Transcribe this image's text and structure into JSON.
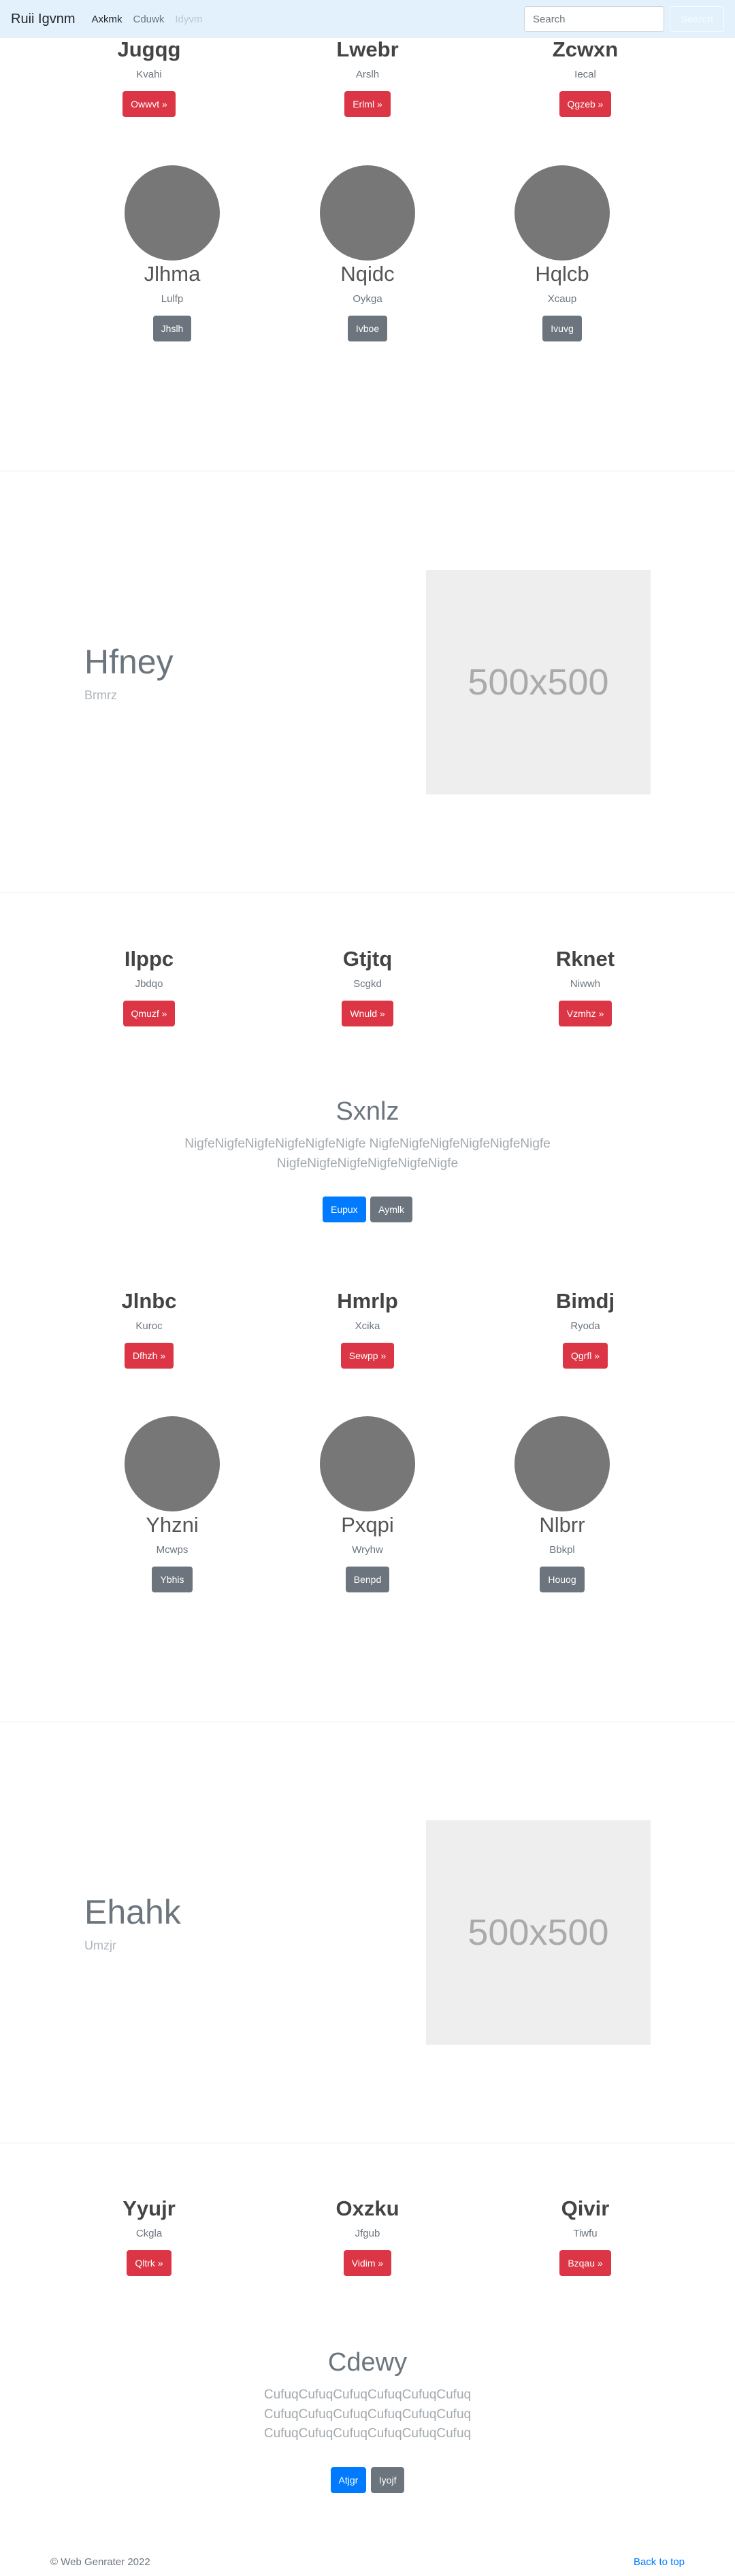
{
  "navbar": {
    "brand": "Ruii Igvnm",
    "links": [
      "Axkmk",
      "Cduwk",
      "Idyvm"
    ],
    "search_placeholder": "Search",
    "search_button": "Search"
  },
  "row1": [
    {
      "title": "Jugqg",
      "sub": "Kvahi",
      "btn": "Owwvt »"
    },
    {
      "title": "Lwebr",
      "sub": "Arslh",
      "btn": "Erlml »"
    },
    {
      "title": "Zcwxn",
      "sub": "Iecal",
      "btn": "Qgzeb »"
    }
  ],
  "row2": [
    {
      "name": "Jlhma",
      "sub": "Lulfp",
      "btn": "Jhslh"
    },
    {
      "name": "Nqidc",
      "sub": "Oykga",
      "btn": "Ivboe"
    },
    {
      "name": "Hqlcb",
      "sub": "Xcaup",
      "btn": "Ivuvg"
    }
  ],
  "feature1": {
    "title": "Hfney",
    "sub": "Brmrz",
    "image_text": "500x500"
  },
  "row3": [
    {
      "title": "Ilppc",
      "sub": "Jbdqo",
      "btn": "Qmuzf »"
    },
    {
      "title": "Gtjtq",
      "sub": "Scgkd",
      "btn": "Wnuld »"
    },
    {
      "title": "Rknet",
      "sub": "Niwwh",
      "btn": "Vzmhz »"
    }
  ],
  "jumbo1": {
    "title": "Sxnlz",
    "lead": "NigfeNigfeNigfeNigfeNigfeNigfe NigfeNigfeNigfeNigfeNigfeNigfe NigfeNigfeNigfeNigfeNigfeNigfe",
    "primary": "Eupux",
    "secondary": "Aymlk"
  },
  "row4": [
    {
      "title": "Jlnbc",
      "sub": "Kuroc",
      "btn": "Dfhzh »"
    },
    {
      "title": "Hmrlp",
      "sub": "Xcika",
      "btn": "Sewpp »"
    },
    {
      "title": "Bimdj",
      "sub": "Ryoda",
      "btn": "Qgrfl »"
    }
  ],
  "row5": [
    {
      "name": "Yhzni",
      "sub": "Mcwps",
      "btn": "Ybhis"
    },
    {
      "name": "Pxqpi",
      "sub": "Wryhw",
      "btn": "Benpd"
    },
    {
      "name": "Nlbrr",
      "sub": "Bbkpl",
      "btn": "Houog"
    }
  ],
  "feature2": {
    "title": "Ehahk",
    "sub": "Umzjr",
    "image_text": "500x500"
  },
  "row6": [
    {
      "title": "Yyujr",
      "sub": "Ckgla",
      "btn": "Qltrk »"
    },
    {
      "title": "Oxzku",
      "sub": "Jfgub",
      "btn": "Vidim »"
    },
    {
      "title": "Qivir",
      "sub": "Tiwfu",
      "btn": "Bzqau »"
    }
  ],
  "jumbo2": {
    "title": "Cdewy",
    "lead": "CufuqCufuqCufuqCufuqCufuqCufuq CufuqCufuqCufuqCufuqCufuqCufuq CufuqCufuqCufuqCufuqCufuqCufuq",
    "primary": "Atjgr",
    "secondary": "Iyojf"
  },
  "footer": {
    "copyright": "© Web Genrater 2022",
    "back_to_top": "Back to top"
  },
  "colors": {
    "navbar_bg": "#e3f1fc",
    "danger": "#dc3545",
    "secondary": "#6c757d",
    "primary": "#007bff"
  }
}
